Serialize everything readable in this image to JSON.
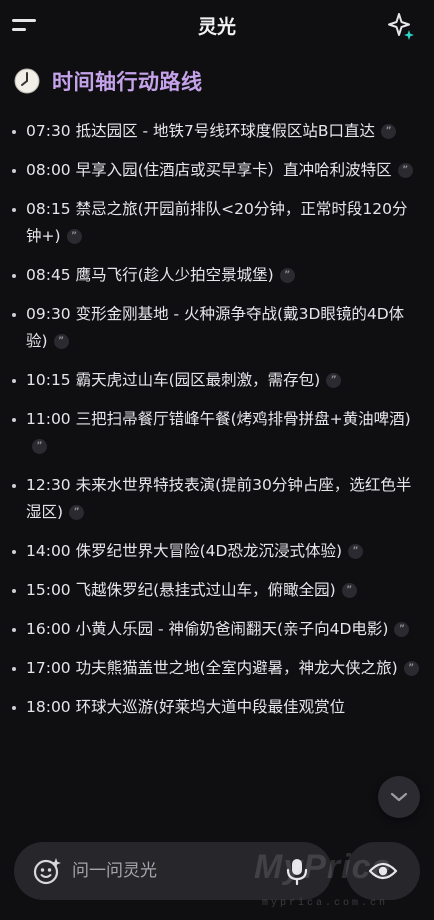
{
  "header": {
    "title": "灵光"
  },
  "section": {
    "title": "时间轴行动路线"
  },
  "timeline": [
    {
      "text": "07:30 抵达园区 - 地铁7号线环球度假区站B口直达"
    },
    {
      "text": "08:00 早享入园(住酒店或买早享卡）直冲哈利波特区"
    },
    {
      "text": "08:15 禁忌之旅(开园前排队<20分钟，正常时段120分钟+)"
    },
    {
      "text": "08:45 鹰马飞行(趁人少拍空景城堡)"
    },
    {
      "text": "09:30 变形金刚基地 - 火种源争夺战(戴3D眼镜的4D体验)"
    },
    {
      "text": "10:15 霸天虎过山车(园区最刺激，需存包)"
    },
    {
      "text": "11:00 三把扫帚餐厅错峰午餐(烤鸡排骨拼盘+黄油啤酒)"
    },
    {
      "text": "12:30 未来水世界特技表演(提前30分钟占座，选红色半湿区)"
    },
    {
      "text": "14:00 侏罗纪世界大冒险(4D恐龙沉浸式体验)"
    },
    {
      "text": "15:00 飞越侏罗纪(悬挂式过山车，俯瞰全园)"
    },
    {
      "text": "16:00 小黄人乐园 - 神偷奶爸闹翻天(亲子向4D电影)"
    },
    {
      "text": "17:00 功夫熊猫盖世之地(全室内避暑，神龙大侠之旅)"
    },
    {
      "text": "18:00 环球大巡游(好莱坞大道中段最佳观赏位"
    }
  ],
  "input": {
    "placeholder": "问一问灵光"
  },
  "watermark": {
    "text": "MyPrice",
    "sub": "myprica.com.cn"
  },
  "icons": {
    "menu": "menu-icon",
    "spark": "sparkle-icon",
    "clock": "clock-icon",
    "quote": "quote-icon",
    "chevron": "chevron-down-icon",
    "mic": "mic-icon",
    "eye": "eye-icon"
  },
  "colors": {
    "accent": "#c5a3ea",
    "background": "#0f0f12",
    "surface": "#26262b"
  }
}
